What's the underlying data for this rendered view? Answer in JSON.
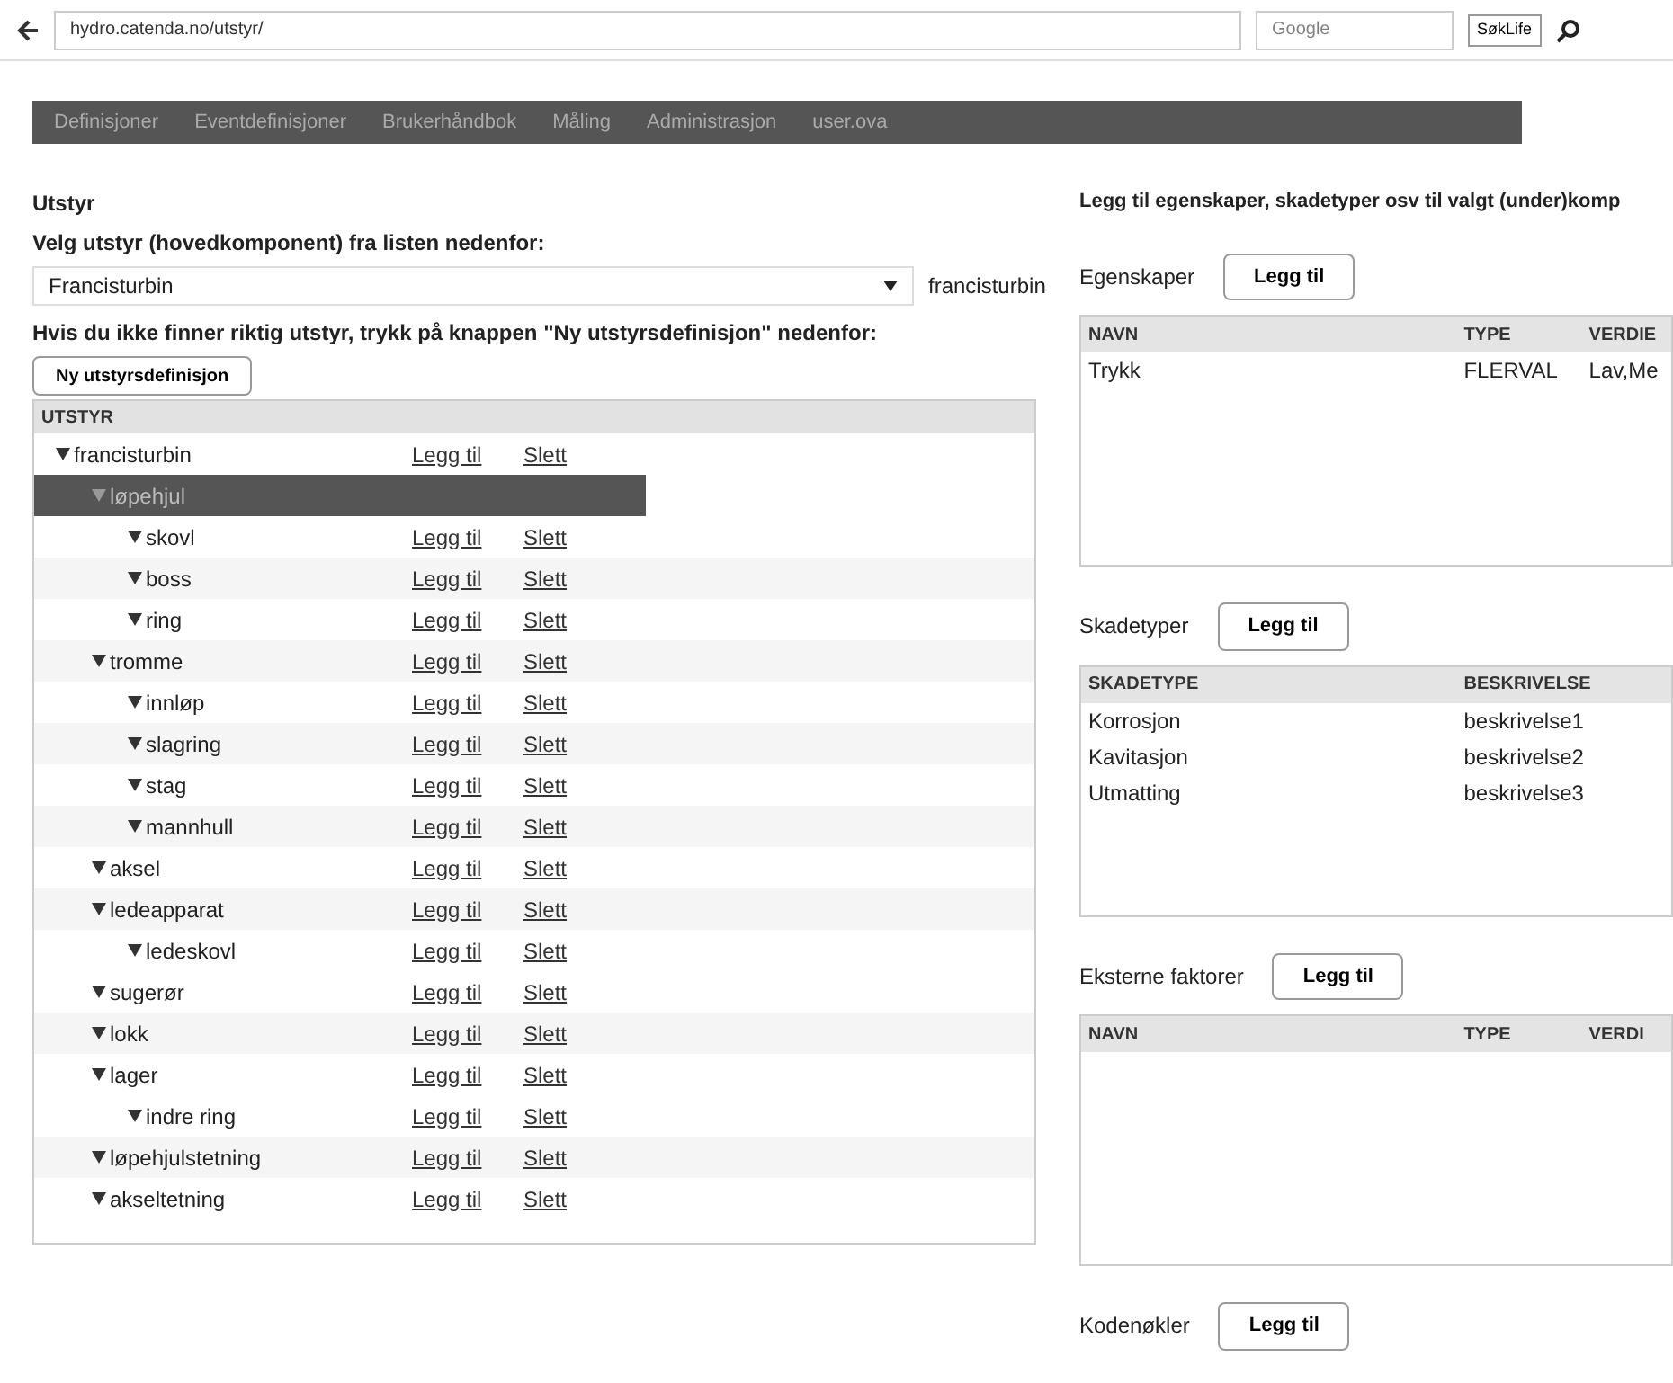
{
  "browser": {
    "url": "hydro.catenda.no/utstyr/",
    "search_placeholder": "Google",
    "search_button": "SøkLife"
  },
  "nav": [
    {
      "label": "Definisjoner"
    },
    {
      "label": "Eventdefinisjoner"
    },
    {
      "label": "Brukerhåndbok"
    },
    {
      "label": "Måling"
    },
    {
      "label": "Administrasjon"
    },
    {
      "label": "user.ova"
    }
  ],
  "left": {
    "title": "Utstyr",
    "select_label": "Velg utstyr (hovedkomponent) fra listen nedenfor:",
    "select_value": "Francisturbin",
    "select_code": "francisturbin",
    "hint": "Hvis du ikke finner riktig utstyr, trykk på knappen \"Ny utstyrsdefinisjon\" nedenfor:",
    "new_button": "Ny utstyrsdefinisjon",
    "tree": {
      "column": "UTSTYR",
      "items": [
        {
          "label": "francisturbin",
          "selected": false,
          "add": "Legg til",
          "delete": "Slett",
          "children": [
            {
              "label": "løpehjul",
              "selected": true,
              "children": [
                {
                  "label": "skovl",
                  "selected": false,
                  "add": "Legg til",
                  "delete": "Slett"
                },
                {
                  "label": "boss",
                  "selected": false,
                  "add": "Legg til",
                  "delete": "Slett"
                },
                {
                  "label": "ring",
                  "selected": false,
                  "add": "Legg til",
                  "delete": "Slett"
                }
              ]
            },
            {
              "label": "tromme",
              "selected": false,
              "add": "Legg til",
              "delete": "Slett",
              "children": [
                {
                  "label": "innløp",
                  "selected": false,
                  "add": "Legg til",
                  "delete": "Slett"
                },
                {
                  "label": "slagring",
                  "selected": false,
                  "add": "Legg til",
                  "delete": "Slett"
                },
                {
                  "label": "stag",
                  "selected": false,
                  "add": "Legg til",
                  "delete": "Slett"
                },
                {
                  "label": "mannhull",
                  "selected": false,
                  "add": "Legg til",
                  "delete": "Slett"
                }
              ]
            },
            {
              "label": "aksel",
              "selected": false,
              "add": "Legg til",
              "delete": "Slett"
            },
            {
              "label": "ledeapparat",
              "selected": false,
              "add": "Legg til",
              "delete": "Slett",
              "children": [
                {
                  "label": "ledeskovl",
                  "selected": false,
                  "add": "Legg til",
                  "delete": "Slett"
                }
              ]
            },
            {
              "label": "sugerør",
              "selected": false,
              "add": "Legg til",
              "delete": "Slett"
            },
            {
              "label": "lokk",
              "selected": false,
              "add": "Legg til",
              "delete": "Slett"
            },
            {
              "label": "lager",
              "selected": false,
              "add": "Legg til",
              "delete": "Slett",
              "children": [
                {
                  "label": "indre ring",
                  "selected": false,
                  "add": "Legg til",
                  "delete": "Slett"
                }
              ]
            },
            {
              "label": "løpehjulstetning",
              "selected": false,
              "add": "Legg til",
              "delete": "Slett"
            },
            {
              "label": "akseltetning",
              "selected": false,
              "add": "Legg til",
              "delete": "Slett"
            }
          ]
        }
      ]
    }
  },
  "right": {
    "title": "Legg til egenskaper, skadetyper osv til valgt (under)komp",
    "sections": [
      {
        "label": "Egenskaper",
        "button": "Legg til",
        "columns": [
          "NAVN",
          "TYPE",
          "VERDIE"
        ],
        "rows": [
          [
            "Trykk",
            "FLERVAL",
            "Lav,Me"
          ]
        ]
      },
      {
        "label": "Skadetyper",
        "button": "Legg til",
        "columns": [
          "SKADETYPE",
          "BESKRIVELSE"
        ],
        "rows": [
          [
            "Korrosjon",
            "beskrivelse1"
          ],
          [
            "Kavitasjon",
            "beskrivelse2"
          ],
          [
            "Utmatting",
            "beskrivelse3"
          ]
        ]
      },
      {
        "label": "Eksterne faktorer",
        "button": "Legg til",
        "columns": [
          "NAVN",
          "TYPE",
          "VERDI"
        ]
      },
      {
        "label": "Kodenøkler",
        "button": "Legg til"
      }
    ]
  }
}
